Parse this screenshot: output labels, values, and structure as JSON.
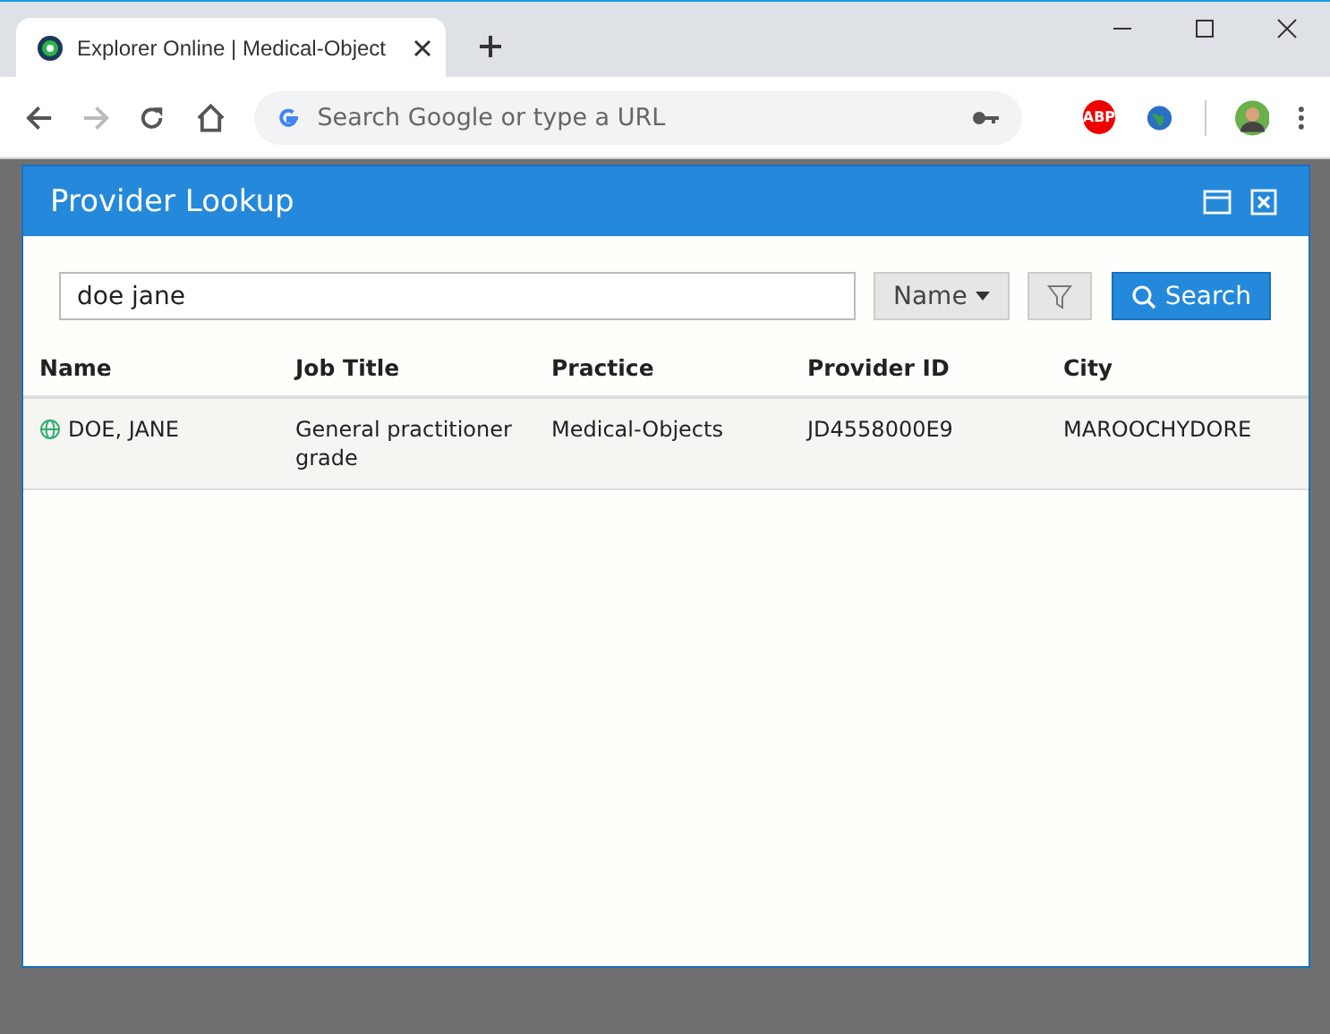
{
  "browser": {
    "tab_title": "Explorer Online | Medical-Object",
    "address_placeholder": "Search Google or type a URL",
    "extension_label": "ABP"
  },
  "dialog": {
    "title": "Provider Lookup",
    "search_value": "doe jane",
    "field_dropdown": "Name",
    "search_button": "Search"
  },
  "table": {
    "columns": [
      "Name",
      "Job Title",
      "Practice",
      "Provider ID",
      "City"
    ],
    "rows": [
      {
        "cells": [
          "DOE, JANE",
          "General practitioner grade",
          "Medical-Objects",
          "JD4558000E9",
          "MAROOCHYDORE"
        ]
      }
    ]
  }
}
